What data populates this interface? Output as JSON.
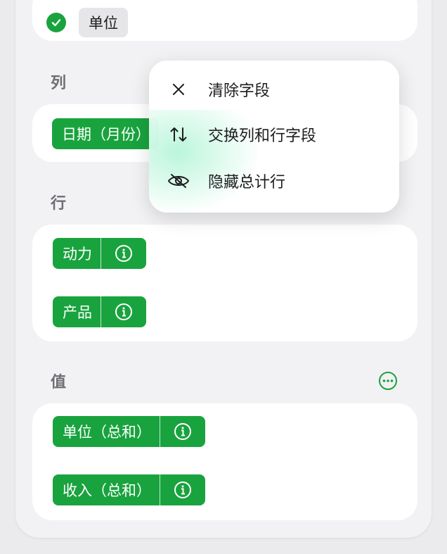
{
  "filter_card": {
    "checked_field": "单位"
  },
  "columns": {
    "label": "列",
    "fields": [
      {
        "label": "日期（月份）"
      }
    ]
  },
  "rows": {
    "label": "行",
    "fields": [
      {
        "label": "动力"
      },
      {
        "label": "产品"
      }
    ]
  },
  "values": {
    "label": "值",
    "fields": [
      {
        "label": "单位（总和）"
      },
      {
        "label": "收入（总和）"
      }
    ]
  },
  "context_menu": {
    "items": [
      {
        "label": "清除字段",
        "icon": "close-icon"
      },
      {
        "label": "交换列和行字段",
        "icon": "swap-arrows-icon"
      },
      {
        "label": "隐藏总计行",
        "icon": "eye-slash-icon"
      }
    ]
  },
  "colors": {
    "accent_green": "#19a33e",
    "panel_bg": "#f2f2f4",
    "card_bg": "#ffffff",
    "label_grey": "#6e6e73"
  }
}
